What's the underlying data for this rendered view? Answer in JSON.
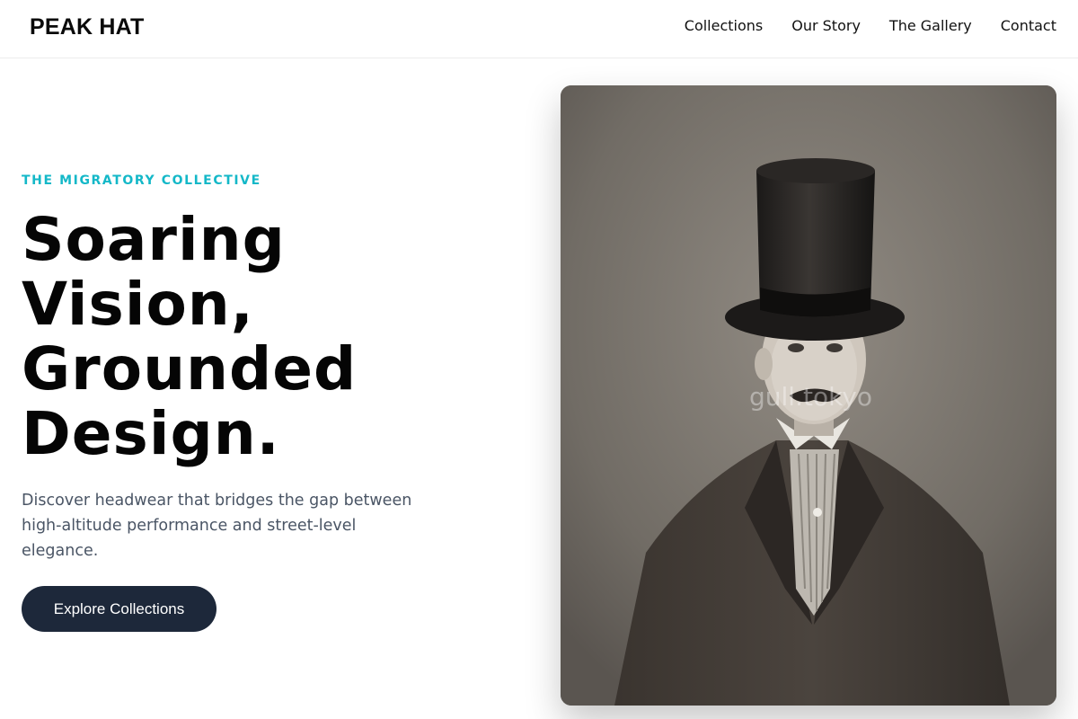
{
  "header": {
    "logo": "PEAK HAT",
    "nav": [
      {
        "label": "Collections"
      },
      {
        "label": "Our Story"
      },
      {
        "label": "The Gallery"
      },
      {
        "label": "Contact"
      }
    ]
  },
  "hero": {
    "eyebrow": "THE MIGRATORY COLLECTIVE",
    "headline_lines": [
      "Soaring",
      "Vision,",
      "Grounded",
      "Design."
    ],
    "subtitle": "Discover headwear that bridges the gap between high-altitude performance and street-level elegance.",
    "cta_label": "Explore Collections"
  },
  "image": {
    "watermark": "gull.tokyo"
  },
  "colors": {
    "accent": "#14b8c8",
    "cta_bg": "#1d283a",
    "text_muted": "#4a5565"
  }
}
